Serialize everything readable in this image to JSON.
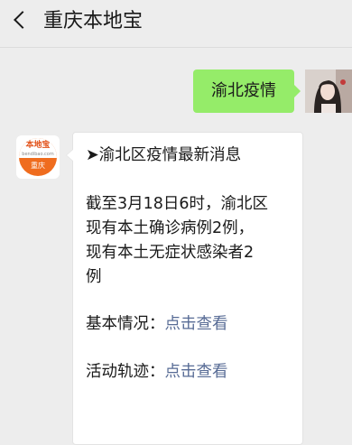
{
  "header": {
    "title": "重庆本地宝"
  },
  "chat": {
    "user_message": "渝北疫情",
    "bot": {
      "logo_brand": "本地宝",
      "logo_url": "bendibao.com",
      "logo_city": "重庆",
      "headline": "➤渝北区疫情最新消息",
      "body_lines": [
        "截至3月18日6时，渝北区",
        "现有本土确诊病例2例，",
        "现有本土无症状感染者2",
        "例"
      ],
      "basic_info_label": "基本情况：",
      "basic_info_link": "点击查看",
      "track_label": "活动轨迹：",
      "track_link": "点击查看"
    }
  },
  "colors": {
    "user_bubble": "#95ec69",
    "link": "#576b95",
    "brand_orange": "#ef6c1e",
    "background": "#ededed"
  }
}
